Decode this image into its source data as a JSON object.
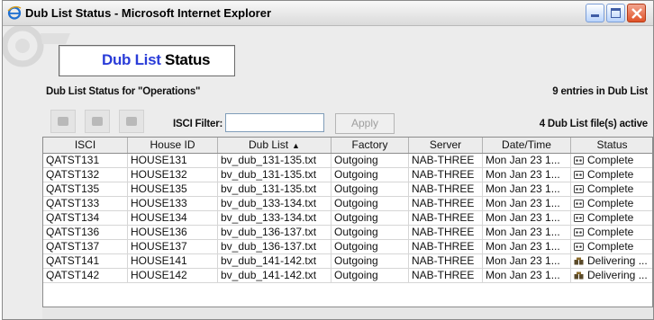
{
  "window": {
    "title": "Dub List Status - Microsoft Internet Explorer"
  },
  "header": {
    "title_dub": "Dub",
    "title_list": " List",
    "title_status": " Status"
  },
  "summary": {
    "subtitle": "Dub List Status for \"Operations\"",
    "entries": "9 entries in Dub List",
    "files_active": "4 Dub List file(s) active"
  },
  "filter": {
    "label": "ISCI Filter:",
    "value": "",
    "apply_label": "Apply"
  },
  "table": {
    "columns": [
      "ISCI",
      "House ID",
      "Dub List",
      "Factory",
      "Server",
      "Date/Time",
      "Status"
    ],
    "sort_indicator": "▲",
    "rows": [
      [
        "QATST131",
        "HOUSE131",
        "bv_dub_131-135.txt",
        "Outgoing",
        "NAB-THREE",
        "Mon Jan 23 1...",
        "Complete"
      ],
      [
        "QATST132",
        "HOUSE132",
        "bv_dub_131-135.txt",
        "Outgoing",
        "NAB-THREE",
        "Mon Jan 23 1...",
        "Complete"
      ],
      [
        "QATST135",
        "HOUSE135",
        "bv_dub_131-135.txt",
        "Outgoing",
        "NAB-THREE",
        "Mon Jan 23 1...",
        "Complete"
      ],
      [
        "QATST133",
        "HOUSE133",
        "bv_dub_133-134.txt",
        "Outgoing",
        "NAB-THREE",
        "Mon Jan 23 1...",
        "Complete"
      ],
      [
        "QATST134",
        "HOUSE134",
        "bv_dub_133-134.txt",
        "Outgoing",
        "NAB-THREE",
        "Mon Jan 23 1...",
        "Complete"
      ],
      [
        "QATST136",
        "HOUSE136",
        "bv_dub_136-137.txt",
        "Outgoing",
        "NAB-THREE",
        "Mon Jan 23 1...",
        "Complete"
      ],
      [
        "QATST137",
        "HOUSE137",
        "bv_dub_136-137.txt",
        "Outgoing",
        "NAB-THREE",
        "Mon Jan 23 1...",
        "Complete"
      ],
      [
        "QATST141",
        "HOUSE141",
        "bv_dub_141-142.txt",
        "Outgoing",
        "NAB-THREE",
        "Mon Jan 23 1...",
        "Delivering ..."
      ],
      [
        "QATST142",
        "HOUSE142",
        "bv_dub_141-142.txt",
        "Outgoing",
        "NAB-THREE",
        "Mon Jan 23 1...",
        "Delivering ..."
      ]
    ],
    "status_icons": {
      "Complete": "tape-icon",
      "Delivering ...": "delivery-icon"
    }
  },
  "colors": {
    "title_accent": "#2a3cd8"
  }
}
